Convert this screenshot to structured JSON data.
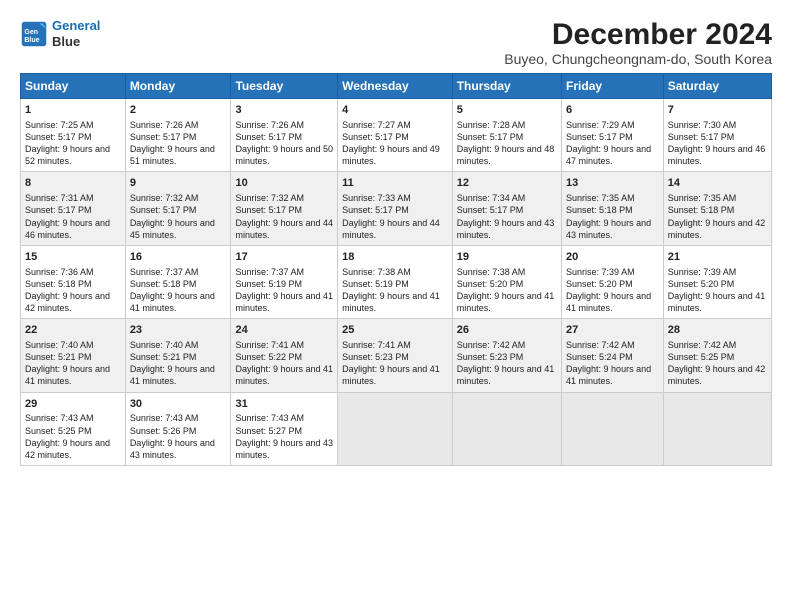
{
  "header": {
    "logo_line1": "General",
    "logo_line2": "Blue",
    "main_title": "December 2024",
    "subtitle": "Buyeo, Chungcheongnam-do, South Korea"
  },
  "days_of_week": [
    "Sunday",
    "Monday",
    "Tuesday",
    "Wednesday",
    "Thursday",
    "Friday",
    "Saturday"
  ],
  "weeks": [
    [
      {
        "day": 1,
        "sunrise": "Sunrise: 7:25 AM",
        "sunset": "Sunset: 5:17 PM",
        "daylight": "Daylight: 9 hours and 52 minutes."
      },
      {
        "day": 2,
        "sunrise": "Sunrise: 7:26 AM",
        "sunset": "Sunset: 5:17 PM",
        "daylight": "Daylight: 9 hours and 51 minutes."
      },
      {
        "day": 3,
        "sunrise": "Sunrise: 7:26 AM",
        "sunset": "Sunset: 5:17 PM",
        "daylight": "Daylight: 9 hours and 50 minutes."
      },
      {
        "day": 4,
        "sunrise": "Sunrise: 7:27 AM",
        "sunset": "Sunset: 5:17 PM",
        "daylight": "Daylight: 9 hours and 49 minutes."
      },
      {
        "day": 5,
        "sunrise": "Sunrise: 7:28 AM",
        "sunset": "Sunset: 5:17 PM",
        "daylight": "Daylight: 9 hours and 48 minutes."
      },
      {
        "day": 6,
        "sunrise": "Sunrise: 7:29 AM",
        "sunset": "Sunset: 5:17 PM",
        "daylight": "Daylight: 9 hours and 47 minutes."
      },
      {
        "day": 7,
        "sunrise": "Sunrise: 7:30 AM",
        "sunset": "Sunset: 5:17 PM",
        "daylight": "Daylight: 9 hours and 46 minutes."
      }
    ],
    [
      {
        "day": 8,
        "sunrise": "Sunrise: 7:31 AM",
        "sunset": "Sunset: 5:17 PM",
        "daylight": "Daylight: 9 hours and 46 minutes."
      },
      {
        "day": 9,
        "sunrise": "Sunrise: 7:32 AM",
        "sunset": "Sunset: 5:17 PM",
        "daylight": "Daylight: 9 hours and 45 minutes."
      },
      {
        "day": 10,
        "sunrise": "Sunrise: 7:32 AM",
        "sunset": "Sunset: 5:17 PM",
        "daylight": "Daylight: 9 hours and 44 minutes."
      },
      {
        "day": 11,
        "sunrise": "Sunrise: 7:33 AM",
        "sunset": "Sunset: 5:17 PM",
        "daylight": "Daylight: 9 hours and 44 minutes."
      },
      {
        "day": 12,
        "sunrise": "Sunrise: 7:34 AM",
        "sunset": "Sunset: 5:17 PM",
        "daylight": "Daylight: 9 hours and 43 minutes."
      },
      {
        "day": 13,
        "sunrise": "Sunrise: 7:35 AM",
        "sunset": "Sunset: 5:18 PM",
        "daylight": "Daylight: 9 hours and 43 minutes."
      },
      {
        "day": 14,
        "sunrise": "Sunrise: 7:35 AM",
        "sunset": "Sunset: 5:18 PM",
        "daylight": "Daylight: 9 hours and 42 minutes."
      }
    ],
    [
      {
        "day": 15,
        "sunrise": "Sunrise: 7:36 AM",
        "sunset": "Sunset: 5:18 PM",
        "daylight": "Daylight: 9 hours and 42 minutes."
      },
      {
        "day": 16,
        "sunrise": "Sunrise: 7:37 AM",
        "sunset": "Sunset: 5:18 PM",
        "daylight": "Daylight: 9 hours and 41 minutes."
      },
      {
        "day": 17,
        "sunrise": "Sunrise: 7:37 AM",
        "sunset": "Sunset: 5:19 PM",
        "daylight": "Daylight: 9 hours and 41 minutes."
      },
      {
        "day": 18,
        "sunrise": "Sunrise: 7:38 AM",
        "sunset": "Sunset: 5:19 PM",
        "daylight": "Daylight: 9 hours and 41 minutes."
      },
      {
        "day": 19,
        "sunrise": "Sunrise: 7:38 AM",
        "sunset": "Sunset: 5:20 PM",
        "daylight": "Daylight: 9 hours and 41 minutes."
      },
      {
        "day": 20,
        "sunrise": "Sunrise: 7:39 AM",
        "sunset": "Sunset: 5:20 PM",
        "daylight": "Daylight: 9 hours and 41 minutes."
      },
      {
        "day": 21,
        "sunrise": "Sunrise: 7:39 AM",
        "sunset": "Sunset: 5:20 PM",
        "daylight": "Daylight: 9 hours and 41 minutes."
      }
    ],
    [
      {
        "day": 22,
        "sunrise": "Sunrise: 7:40 AM",
        "sunset": "Sunset: 5:21 PM",
        "daylight": "Daylight: 9 hours and 41 minutes."
      },
      {
        "day": 23,
        "sunrise": "Sunrise: 7:40 AM",
        "sunset": "Sunset: 5:21 PM",
        "daylight": "Daylight: 9 hours and 41 minutes."
      },
      {
        "day": 24,
        "sunrise": "Sunrise: 7:41 AM",
        "sunset": "Sunset: 5:22 PM",
        "daylight": "Daylight: 9 hours and 41 minutes."
      },
      {
        "day": 25,
        "sunrise": "Sunrise: 7:41 AM",
        "sunset": "Sunset: 5:23 PM",
        "daylight": "Daylight: 9 hours and 41 minutes."
      },
      {
        "day": 26,
        "sunrise": "Sunrise: 7:42 AM",
        "sunset": "Sunset: 5:23 PM",
        "daylight": "Daylight: 9 hours and 41 minutes."
      },
      {
        "day": 27,
        "sunrise": "Sunrise: 7:42 AM",
        "sunset": "Sunset: 5:24 PM",
        "daylight": "Daylight: 9 hours and 41 minutes."
      },
      {
        "day": 28,
        "sunrise": "Sunrise: 7:42 AM",
        "sunset": "Sunset: 5:25 PM",
        "daylight": "Daylight: 9 hours and 42 minutes."
      }
    ],
    [
      {
        "day": 29,
        "sunrise": "Sunrise: 7:43 AM",
        "sunset": "Sunset: 5:25 PM",
        "daylight": "Daylight: 9 hours and 42 minutes."
      },
      {
        "day": 30,
        "sunrise": "Sunrise: 7:43 AM",
        "sunset": "Sunset: 5:26 PM",
        "daylight": "Daylight: 9 hours and 43 minutes."
      },
      {
        "day": 31,
        "sunrise": "Sunrise: 7:43 AM",
        "sunset": "Sunset: 5:27 PM",
        "daylight": "Daylight: 9 hours and 43 minutes."
      },
      null,
      null,
      null,
      null
    ]
  ]
}
